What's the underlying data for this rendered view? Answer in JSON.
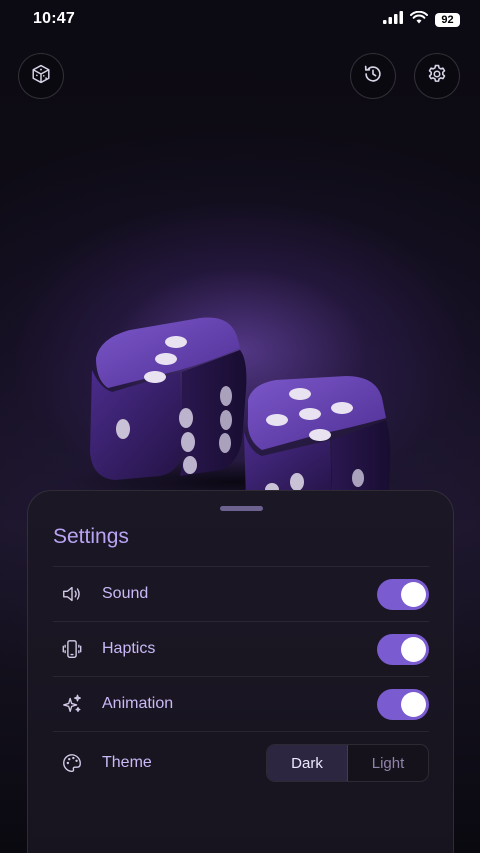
{
  "status_bar": {
    "time": "10:47",
    "battery": "92"
  },
  "top_bar": {
    "left_icon": "dice-icon",
    "right_icons": [
      "history-icon",
      "gear-icon"
    ]
  },
  "settings": {
    "title": "Settings",
    "rows": [
      {
        "label": "Sound",
        "icon": "speaker-icon",
        "enabled": true
      },
      {
        "label": "Haptics",
        "icon": "phone-vibrate-icon",
        "enabled": true
      },
      {
        "label": "Animation",
        "icon": "sparkles-icon",
        "enabled": true
      }
    ],
    "theme": {
      "label": "Theme",
      "icon": "palette-icon",
      "options": [
        "Dark",
        "Light"
      ],
      "selected": "Dark"
    }
  },
  "colors": {
    "accent": "#7a5bd0",
    "title": "#b9a3f3",
    "dice": "#3c2373"
  }
}
